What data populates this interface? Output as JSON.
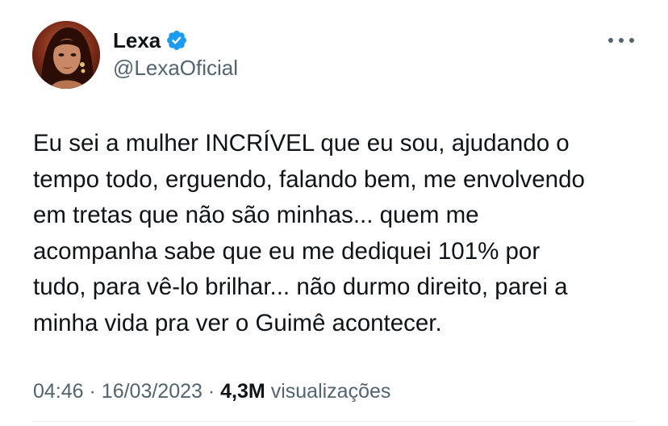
{
  "author": {
    "display_name": "Lexa",
    "handle": "@LexaOficial",
    "verified": true,
    "avatar": "profile-photo"
  },
  "tweet": {
    "lines": [
      "Eu sei a mulher INCRÍVEL que eu sou, ajudando o",
      "tempo todo, erguendo, falando bem, me envolvendo",
      "em tretas que não são minhas... quem me",
      "acompanha sabe que eu me dediquei 101% por",
      "tudo, para vê-lo brilhar... não durmo direito, parei a",
      "minha vida pra ver o Guimê acontecer."
    ]
  },
  "meta": {
    "time": "04:46",
    "separator": "·",
    "date": "16/03/2023",
    "views_count": "4,3M",
    "views_label": "visualizações"
  },
  "icons": {
    "verified": "verified-badge-icon",
    "more": "more-options-icon"
  },
  "colors": {
    "text_primary": "#0f1419",
    "text_secondary": "#536471",
    "verified_blue": "#1d9bf0",
    "divider": "#eff3f4"
  }
}
